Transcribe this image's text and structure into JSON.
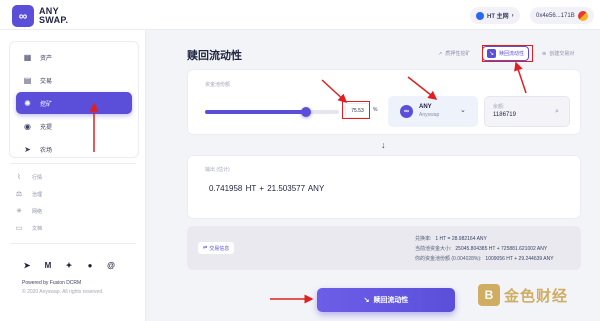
{
  "header": {
    "logo_mark": "∞",
    "logo_line1": "ANY",
    "logo_line2": "SWAP.",
    "network": "HT 主网",
    "address": "0x4e56...171B"
  },
  "sidebar": {
    "items": [
      {
        "label": "资产",
        "icon": "grid-icon",
        "glyph": "▦"
      },
      {
        "label": "交易",
        "icon": "map-icon",
        "glyph": "▤"
      },
      {
        "label": "挖矿",
        "icon": "mining-icon",
        "glyph": "✺"
      },
      {
        "label": "充提",
        "icon": "coins-icon",
        "glyph": "◉"
      },
      {
        "label": "农场",
        "icon": "send-icon",
        "glyph": "➤"
      }
    ],
    "active_index": 2,
    "sub_items": [
      {
        "label": "行情",
        "glyph": "⌇"
      },
      {
        "label": "治理",
        "glyph": "⚖"
      },
      {
        "label": "网络",
        "glyph": "✳"
      },
      {
        "label": "文档",
        "glyph": "▭"
      }
    ],
    "social": [
      {
        "name": "telegram-icon",
        "glyph": "➤"
      },
      {
        "name": "medium-icon",
        "glyph": "M"
      },
      {
        "name": "twitter-icon",
        "glyph": "✦"
      },
      {
        "name": "github-icon",
        "glyph": "●"
      },
      {
        "name": "email-icon",
        "glyph": "@"
      }
    ],
    "powered": "Powered by Fusion DCRM",
    "copyright": "© 2020 Anyswap. All rights reserved."
  },
  "main": {
    "title": "赎回流动性",
    "tabs": [
      {
        "label": "质押性挖矿"
      },
      {
        "label": "赎回流动性"
      },
      {
        "label": "创建交易对"
      }
    ],
    "active_tab": 1,
    "pool_label": "资金池份额",
    "slider_percent": 75.53,
    "percent_value": "75.53",
    "percent_sign": "%",
    "token": {
      "symbol": "ANY",
      "name": "Anyswap",
      "logo": "∞"
    },
    "balance_label": "余额:",
    "balance_value": "1186719",
    "output_label": "输出 (估计)",
    "output_value": "0.741958 HT  +  21.503577 ANY",
    "rate_button": "交易信息",
    "rates": [
      {
        "label": "兑换率:",
        "value": "1 HT = 28.982164 ANY"
      },
      {
        "label": "当前池资金大小:",
        "value": "25045.804385 HT + 725881.621002 ANY"
      },
      {
        "label": "你的资金池份额 (0.004028%):",
        "value": "1009056 HT + 29.244639 ANY"
      }
    ],
    "submit": "赎回流动性"
  },
  "watermark": {
    "mark": "B",
    "text": "金色财经"
  },
  "colors": {
    "accent": "#5b4fd9",
    "annotation": "#e02020",
    "background": "#f3f4f8"
  }
}
